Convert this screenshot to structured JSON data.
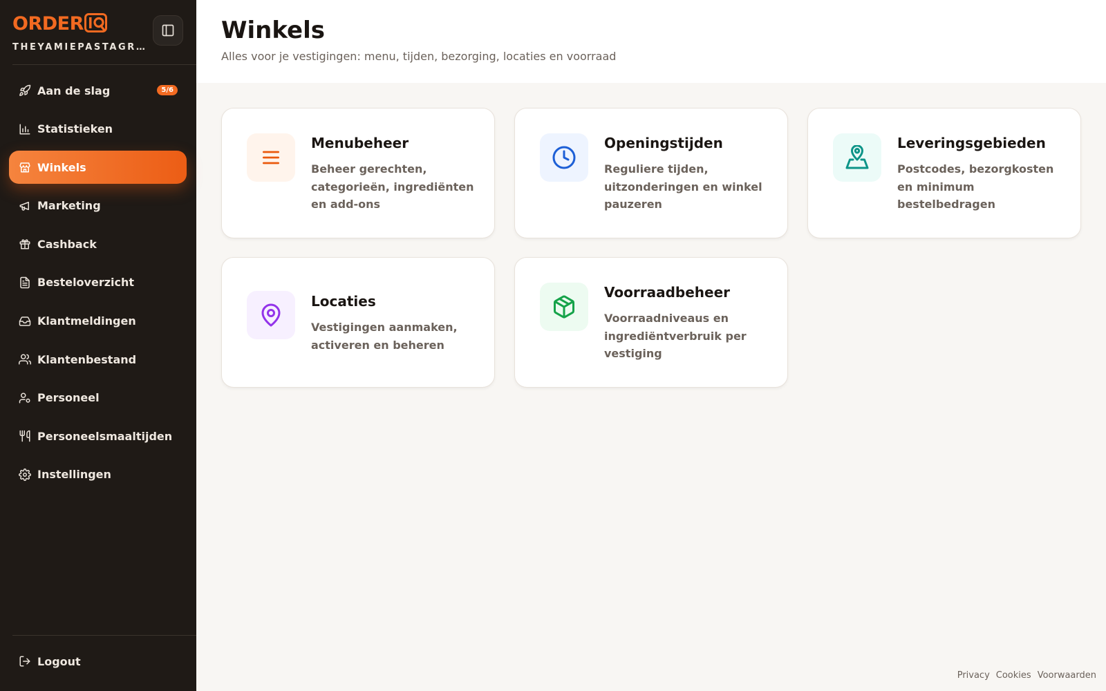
{
  "brand": {
    "logo_text": "ORDER",
    "logo_mark": "IQ",
    "org_name": "THEYAMIEPASTAGROUP",
    "accent_color": "#f26a21"
  },
  "sidebar": {
    "collapse_icon": "sidebar-toggle-icon",
    "items": [
      {
        "label": "Aan de slag",
        "icon": "rocket-icon",
        "badge": "5/6",
        "active": false
      },
      {
        "label": "Statistieken",
        "icon": "bar-chart-icon",
        "active": false
      },
      {
        "label": "Winkels",
        "icon": "store-icon",
        "active": true
      },
      {
        "label": "Marketing",
        "icon": "megaphone-icon",
        "active": false
      },
      {
        "label": "Cashback",
        "icon": "gift-icon",
        "active": false
      },
      {
        "label": "Besteloverzicht",
        "icon": "document-icon",
        "active": false
      },
      {
        "label": "Klantmeldingen",
        "icon": "inbox-icon",
        "active": false
      },
      {
        "label": "Klantenbestand",
        "icon": "users-icon",
        "active": false
      },
      {
        "label": "Personeel",
        "icon": "user-settings-icon",
        "active": false
      },
      {
        "label": "Personeelsmaaltijden",
        "icon": "utensils-icon",
        "active": false
      },
      {
        "label": "Instellingen",
        "icon": "gear-icon",
        "active": false
      }
    ],
    "logout_label": "Logout"
  },
  "header": {
    "title": "Winkels",
    "subtitle": "Alles voor je vestigingen: menu, tijden, bezorging, locaties en voorraad"
  },
  "cards": [
    {
      "title": "Menubeheer",
      "description": "Beheer gerechten, categorieën, ingrediënten en add-ons",
      "icon": "menu-lines-icon",
      "color": "#ea580c",
      "bg": "#fff4ec"
    },
    {
      "title": "Openingstijden",
      "description": "Reguliere tijden, uitzonderingen en winkel pauzeren",
      "icon": "clock-icon",
      "color": "#1d5fd6",
      "bg": "#eef4ff"
    },
    {
      "title": "Leveringsgebieden",
      "description": "Postcodes, bezorgkosten en minimum bestelbedragen",
      "icon": "map-pin-area-icon",
      "color": "#0d9488",
      "bg": "#ecfbf8"
    },
    {
      "title": "Locaties",
      "description": "Vestigingen aanmaken, activeren en beheren",
      "icon": "location-pin-icon",
      "color": "#9333ea",
      "bg": "#f7f0ff"
    },
    {
      "title": "Voorraadbeheer",
      "description": "Voorraadniveaus en ingrediëntverbruik per vestiging",
      "icon": "package-icon",
      "color": "#16a34a",
      "bg": "#edfbf1"
    }
  ],
  "footer": {
    "links": [
      "Privacy",
      "Cookies",
      "Voorwaarden"
    ]
  }
}
